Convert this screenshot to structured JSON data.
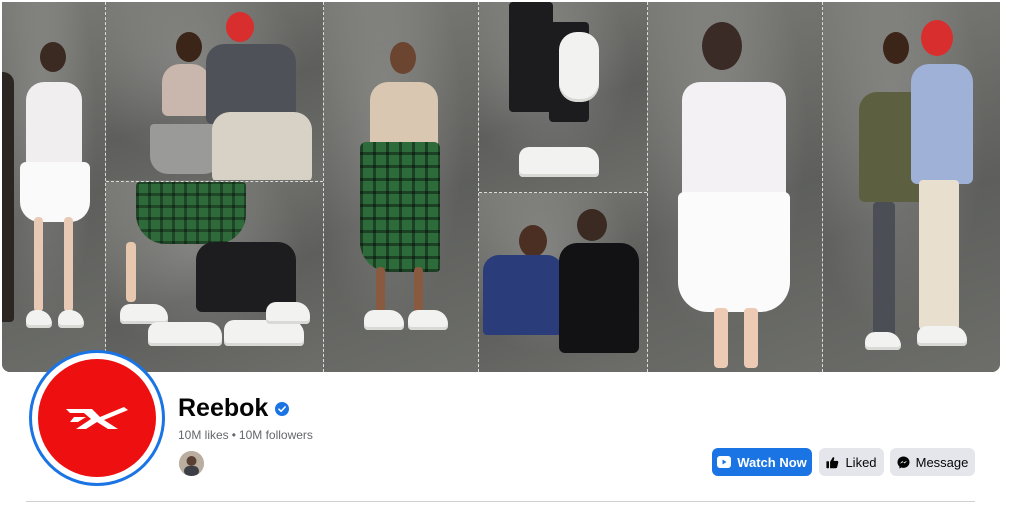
{
  "profile": {
    "name": "Reebok",
    "verified": true,
    "likes": "10M likes",
    "separator": "•",
    "followers": "10M followers",
    "logo_icon": "reebok-delta-logo-icon",
    "verified_icon": "verified-badge-icon"
  },
  "actions": {
    "watch_now": {
      "label": "Watch Now",
      "icon": "video-play-icon"
    },
    "liked": {
      "label": "Liked",
      "icon": "thumbs-up-icon"
    },
    "message": {
      "label": "Message",
      "icon": "messenger-icon"
    }
  },
  "colors": {
    "accent": "#1b74e4",
    "logo_background": "#ee1010",
    "secondary_button": "#e4e6eb",
    "muted_text": "#65676b"
  }
}
